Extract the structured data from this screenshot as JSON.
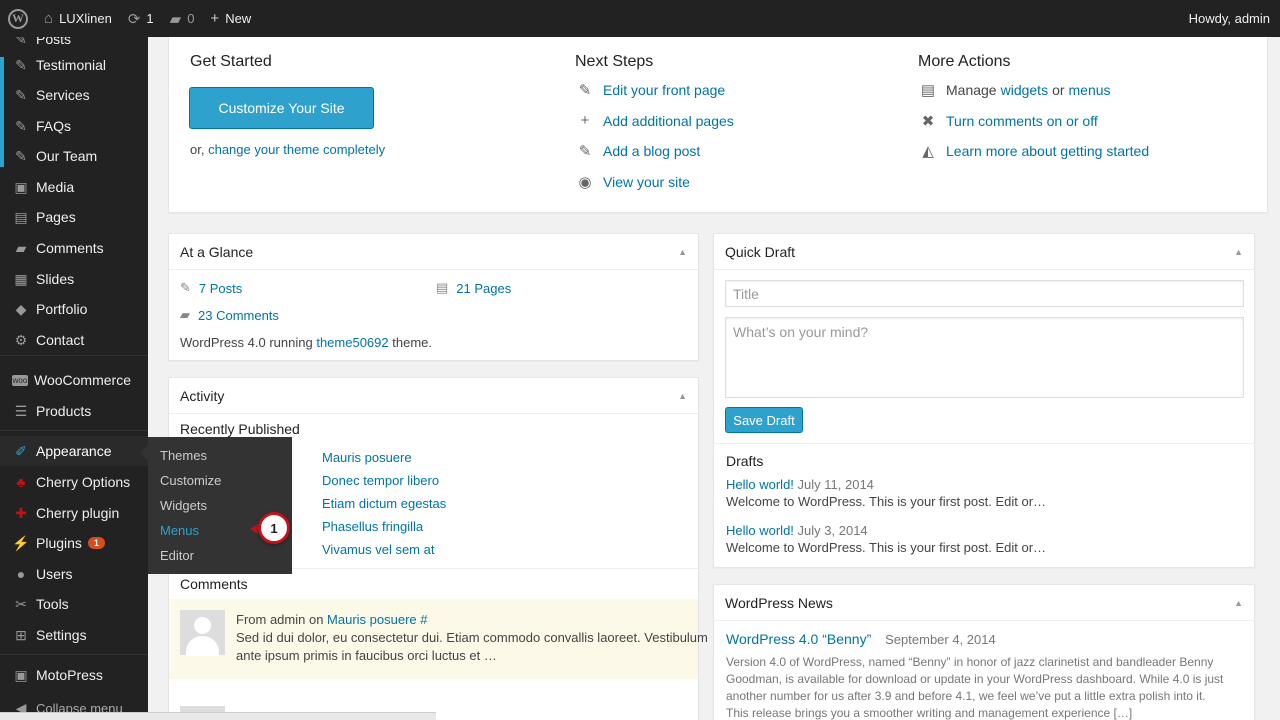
{
  "adminbar": {
    "site_name": "LUXlinen",
    "updates_count": "1",
    "comments_count": "0",
    "new_label": "New",
    "greeting": "Howdy, admin"
  },
  "sidebar": {
    "items": [
      {
        "label": "Posts",
        "icon": "pushpin-icon"
      },
      {
        "label": "Testimonial",
        "icon": "pushpin-icon"
      },
      {
        "label": "Services",
        "icon": "pushpin-icon"
      },
      {
        "label": "FAQs",
        "icon": "pushpin-icon"
      },
      {
        "label": "Our Team",
        "icon": "pushpin-icon"
      },
      {
        "label": "Media",
        "icon": "media-icon"
      },
      {
        "label": "Pages",
        "icon": "pages-icon"
      },
      {
        "label": "Comments",
        "icon": "comment-icon"
      },
      {
        "label": "Slides",
        "icon": "slides-icon"
      },
      {
        "label": "Portfolio",
        "icon": "portfolio-icon"
      },
      {
        "label": "Contact",
        "icon": "gear-icon"
      },
      {
        "label": "WooCommerce",
        "icon": "woo-icon"
      },
      {
        "label": "Products",
        "icon": "products-icon"
      },
      {
        "label": "Appearance",
        "icon": "brush-icon"
      },
      {
        "label": "Cherry Options",
        "icon": "cherry-icon"
      },
      {
        "label": "Cherry plugin",
        "icon": "puzzle-icon"
      },
      {
        "label": "Plugins",
        "icon": "plug-icon",
        "badge": "1"
      },
      {
        "label": "Users",
        "icon": "user-icon"
      },
      {
        "label": "Tools",
        "icon": "wrench-icon"
      },
      {
        "label": "Settings",
        "icon": "settings-icon"
      },
      {
        "label": "MotoPress",
        "icon": "motopress-icon"
      }
    ],
    "collapse_label": "Collapse menu",
    "flyout": [
      "Themes",
      "Customize",
      "Widgets",
      "Menus",
      "Editor"
    ],
    "callout_number": "1"
  },
  "welcome": {
    "get_started": {
      "title": "Get Started",
      "button": "Customize Your Site",
      "or_prefix": "or,",
      "change_theme": "change your theme completely"
    },
    "next_steps": {
      "title": "Next Steps",
      "items": [
        "Edit your front page",
        "Add additional pages",
        "Add a blog post",
        "View your site"
      ]
    },
    "more_actions": {
      "title": "More Actions",
      "manage_prefix": "Manage",
      "widgets": "widgets",
      "or": "or",
      "menus": "menus",
      "comments_toggle": "Turn comments on or off",
      "learn_more": "Learn more about getting started"
    }
  },
  "glance": {
    "title": "At a Glance",
    "posts": "7 Posts",
    "pages": "21 Pages",
    "comments": "23 Comments",
    "running_prefix": "WordPress 4.0 running",
    "theme": "theme50692",
    "running_suffix": "theme."
  },
  "activity": {
    "title": "Activity",
    "recently_published": "Recently Published",
    "posts": [
      "Mauris posuere",
      "Donec tempor libero",
      "Etiam dictum egestas",
      "Phasellus fringilla",
      "Vivamus vel sem at"
    ],
    "comments_heading": "Comments",
    "comment": {
      "from_prefix": "From admin on",
      "post_link": "Mauris posuere #",
      "text_line1": "Sed id dui dolor, eu consectetur dui. Etiam commodo convallis laoreet. Vestibulum",
      "text_line2": "ante ipsum primis in faucibus orci luctus et …"
    }
  },
  "quick_draft": {
    "title": "Quick Draft",
    "title_placeholder": "Title",
    "content_placeholder": "What’s on your mind?",
    "save_button": "Save Draft",
    "drafts_heading": "Drafts",
    "drafts": [
      {
        "title": "Hello world!",
        "date": "July 11, 2014",
        "excerpt": "Welcome to WordPress. This is your first post. Edit or…"
      },
      {
        "title": "Hello world!",
        "date": "July 3, 2014",
        "excerpt": "Welcome to WordPress. This is your first post. Edit or…"
      }
    ]
  },
  "news": {
    "title": "WordPress News",
    "headline": "WordPress 4.0 “Benny”",
    "date": "September 4, 2014",
    "lines": [
      "Version 4.0 of WordPress, named “Benny” in honor of jazz clarinetist and bandleader Benny",
      "Goodman, is available for download or update in your WordPress dashboard. While 4.0 is just",
      "another number for us after 3.9 and before 4.1, we feel we’ve put a little extra polish into it.",
      "This release brings you a smoother writing and management experience […]"
    ]
  },
  "colors": {
    "accent": "#0074a2",
    "button": "#2ea2cc",
    "sidebar_bg": "#222222",
    "badge": "#d54e21",
    "callout_ring": "#c0121b"
  }
}
